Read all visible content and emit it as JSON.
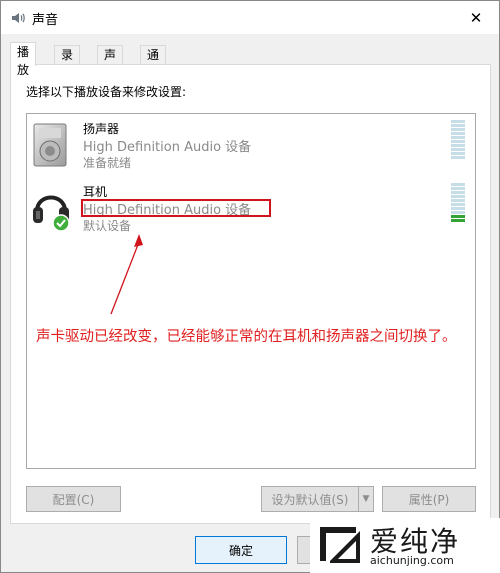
{
  "window": {
    "title": "声音",
    "close_glyph": "✕"
  },
  "tabs": [
    {
      "label": "播放",
      "active": true
    },
    {
      "label": "录制",
      "active": false
    },
    {
      "label": "声音",
      "active": false
    },
    {
      "label": "通信",
      "active": false
    }
  ],
  "panel": {
    "instruction": "选择以下播放设备来修改设置:"
  },
  "devices": [
    {
      "name": "扬声器",
      "description": "High Definition Audio 设备",
      "status": "准备就绪",
      "icon": "speaker-icon",
      "level_active_bars": 0,
      "level_total_bars": 10
    },
    {
      "name": "耳机",
      "description": "High Definition Audio 设备",
      "status": "默认设备",
      "icon": "headphones-icon",
      "default": true,
      "level_active_bars": 2,
      "level_total_bars": 10
    }
  ],
  "annotation": {
    "text": "声卡驱动已经改变，已经能够正常的在耳机和扬声器之间切换了。",
    "color": "#e02020"
  },
  "buttons": {
    "configure": "配置(C)",
    "set_default": "设为默认值(S)",
    "properties": "属性(P)",
    "ok": "确定",
    "cancel": ""
  },
  "watermark": {
    "big_text": "爱纯净",
    "small_text": "aichunjing.com"
  },
  "colors": {
    "accent": "#0078d7",
    "annotation_red": "#d0141c",
    "level_green": "#33a336"
  }
}
